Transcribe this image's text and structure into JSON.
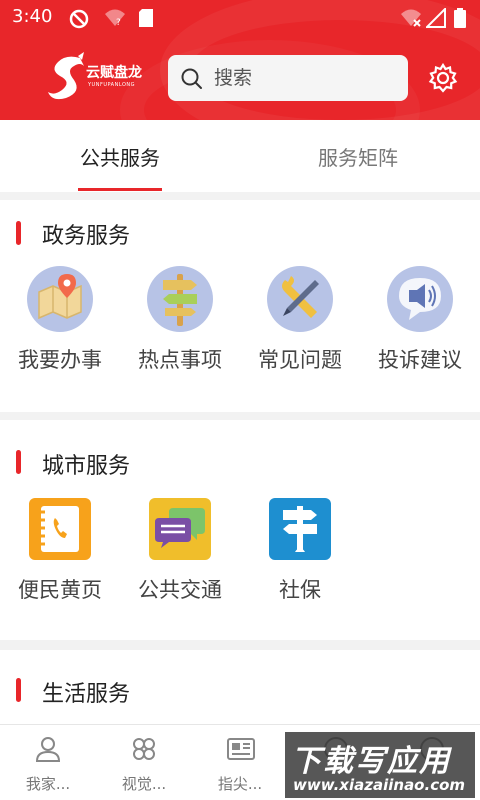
{
  "status_bar": {
    "time": "3:40"
  },
  "header": {
    "logo_text": "云赋盘龙",
    "logo_subtext": "YUNFUPANLONG",
    "search_placeholder": "搜索",
    "settings_icon": "gear-icon"
  },
  "tabs": [
    {
      "label": "公共服务",
      "active": true
    },
    {
      "label": "服务矩阵",
      "active": false
    }
  ],
  "sections": [
    {
      "title": "政务服务",
      "items": [
        {
          "label": "我要办事",
          "icon": "map-pin-icon"
        },
        {
          "label": "热点事项",
          "icon": "signpost-icon"
        },
        {
          "label": "常见问题",
          "icon": "tools-icon"
        },
        {
          "label": "投诉建议",
          "icon": "megaphone-icon"
        }
      ]
    },
    {
      "title": "城市服务",
      "items": [
        {
          "label": "便民黄页",
          "icon": "phonebook-icon"
        },
        {
          "label": "公共交通",
          "icon": "chat-bubbles-icon"
        },
        {
          "label": "社保",
          "icon": "direction-sign-icon"
        }
      ]
    },
    {
      "title": "生活服务",
      "items": []
    }
  ],
  "bottom_nav": [
    {
      "label": "我家...",
      "icon": "person-icon"
    },
    {
      "label": "视觉...",
      "icon": "clover-icon"
    },
    {
      "label": "指尖...",
      "icon": "newspaper-icon"
    },
    {
      "label": "",
      "icon": "news-icon"
    },
    {
      "label": "",
      "icon": "compass-icon"
    }
  ],
  "watermark": {
    "main": "下载写应用",
    "sub": "www.xiazaiinao.com"
  },
  "colors": {
    "brand_red": "#e8262a"
  }
}
